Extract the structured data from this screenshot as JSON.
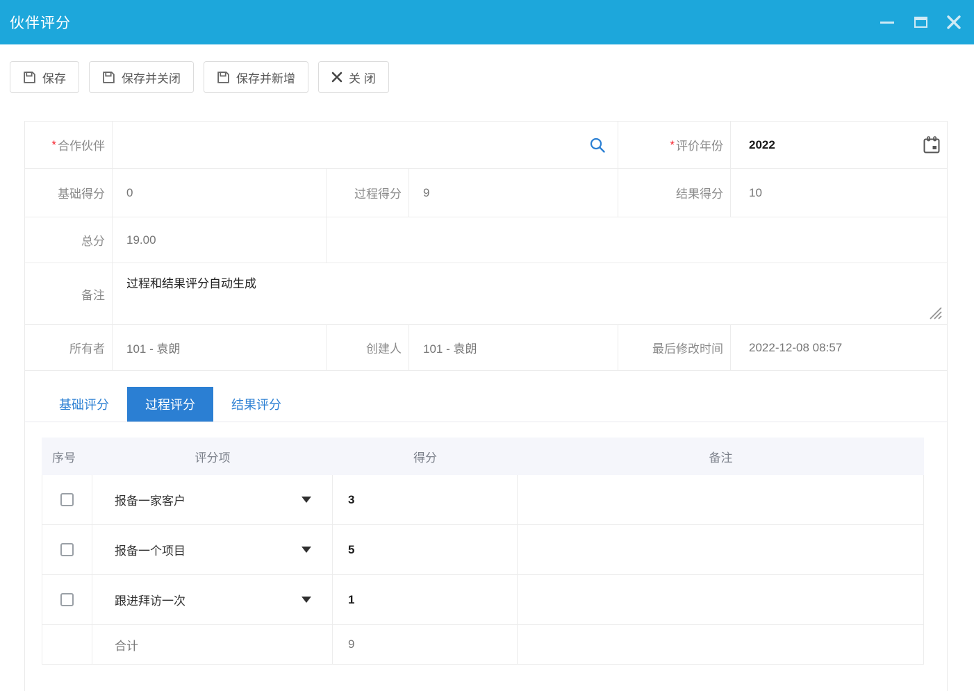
{
  "window": {
    "title": "伙伴评分"
  },
  "toolbar": {
    "save": "保存",
    "save_close": "保存并关闭",
    "save_new": "保存并新增",
    "close": "关 闭"
  },
  "misc": {
    "required_mark": "*"
  },
  "form": {
    "partner": {
      "label": "合作伙伴",
      "value": "",
      "required": true
    },
    "year": {
      "label": "评价年份",
      "value": "2022",
      "required": true
    },
    "base_score": {
      "label": "基础得分",
      "value": "0"
    },
    "process_score": {
      "label": "过程得分",
      "value": "9"
    },
    "result_score": {
      "label": "结果得分",
      "value": "10"
    },
    "total_score": {
      "label": "总分",
      "value": "19.00"
    },
    "remark": {
      "label": "备注",
      "value": "过程和结果评分自动生成"
    },
    "owner": {
      "label": "所有者",
      "value": "101 - 袁朗"
    },
    "creator": {
      "label": "创建人",
      "value": "101 - 袁朗"
    },
    "last_modified": {
      "label": "最后修改时间",
      "value": "2022-12-08 08:57"
    }
  },
  "tabs": [
    {
      "label": "基础评分",
      "active": false
    },
    {
      "label": "过程评分",
      "active": true
    },
    {
      "label": "结果评分",
      "active": false
    }
  ],
  "score_table": {
    "headers": [
      "序号",
      "评分项",
      "得分",
      "备注"
    ],
    "rows": [
      {
        "item": "报备一家客户",
        "score": "3",
        "remark": "",
        "checked": false
      },
      {
        "item": "报备一个项目",
        "score": "5",
        "remark": "",
        "checked": false
      },
      {
        "item": "跟进拜访一次",
        "score": "1",
        "remark": "",
        "checked": false
      }
    ],
    "total": {
      "label": "合计",
      "score": "9"
    }
  },
  "icons": {
    "save": "floppy-disk",
    "close": "x-mark",
    "search": "magnifier",
    "calendar": "calendar",
    "resize": "diagonal-grip",
    "dropdown": "triangle-down",
    "minimize": "dash",
    "maximize": "square",
    "window_close": "x-mark"
  },
  "colors": {
    "titlebar_bg": "#1DA7DB",
    "accent_blue": "#2B7FD3",
    "required_red": "#F5222D",
    "border": "#ECECEC",
    "table_header_bg": "#F5F6FB",
    "label_gray": "#8B8B8B",
    "value_gray": "#767676",
    "dark_text": "#1A1A1A"
  }
}
